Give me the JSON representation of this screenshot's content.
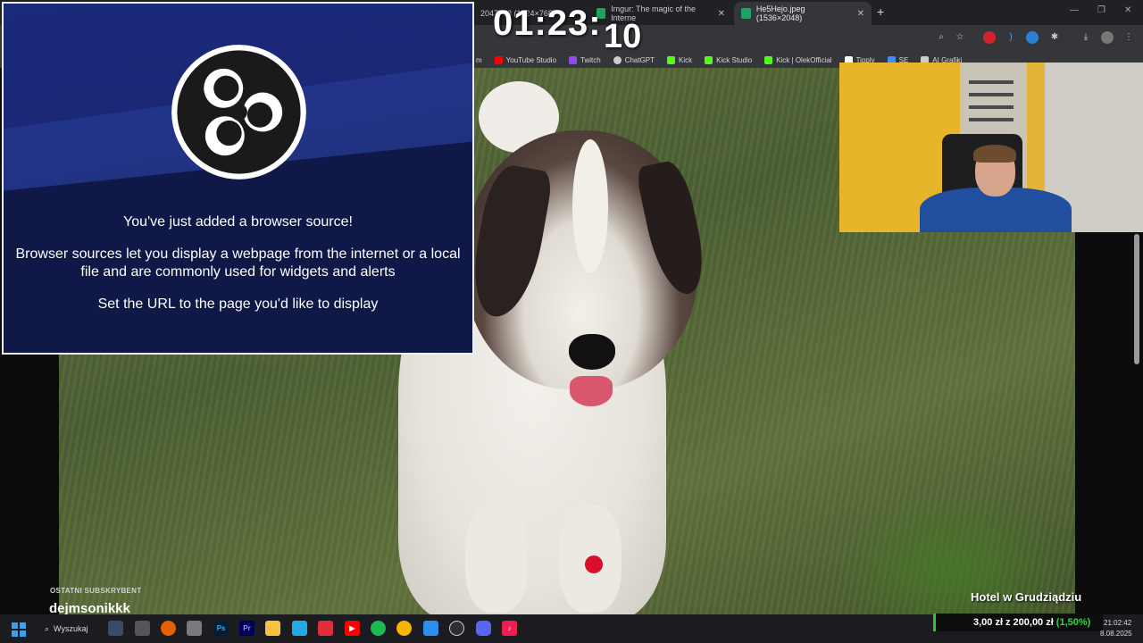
{
  "browser": {
    "tabs": [
      {
        "label": "2047778 (1024×768)",
        "active": false
      },
      {
        "label": "Imgur: The magic of the Interne",
        "active": false
      },
      {
        "label": "He5Hejo.jpeg (1536×2048)",
        "active": true
      }
    ],
    "new_tab": "+",
    "bookmarks": [
      {
        "label": "m",
        "color": "#888888"
      },
      {
        "label": "YouTube Studio",
        "color": "#ff0000"
      },
      {
        "label": "Twitch",
        "color": "#9146ff"
      },
      {
        "label": "ChatGPT",
        "color": "#cccccc"
      },
      {
        "label": "Kick",
        "color": "#53fc18"
      },
      {
        "label": "Kick Studio",
        "color": "#53fc18"
      },
      {
        "label": "Kick | OlekOfficial",
        "color": "#53fc18"
      },
      {
        "label": "Tipply",
        "color": "#ffffff"
      },
      {
        "label": "SE",
        "color": "#3c8dff"
      },
      {
        "label": "AI Grafiki",
        "color": "#cccccc"
      }
    ]
  },
  "clock": {
    "main": "01:23:",
    "seconds": "10"
  },
  "obs_source": {
    "line1": "You've just added a browser source!",
    "line2a": "Browser sources let you display a webpage from the internet or a local",
    "line2b": "file and are commonly used for widgets and alerts",
    "line3": "Set the URL to the page you'd like to display"
  },
  "overlay": {
    "last_sub_label": "OSTATNI SUBSKRYBENT",
    "last_sub_name": "dejmsonikkk",
    "location": "Hotel w Grudziądziu",
    "donation_amount": "3,00 zł",
    "donation_z": "z",
    "donation_goal": "200,00 zł",
    "donation_pct": "(1,50%)",
    "accent": "#2ec53a"
  },
  "taskbar": {
    "search_label": "Wyszukaj",
    "time": "21:02:42",
    "date": "8.08.2025"
  }
}
